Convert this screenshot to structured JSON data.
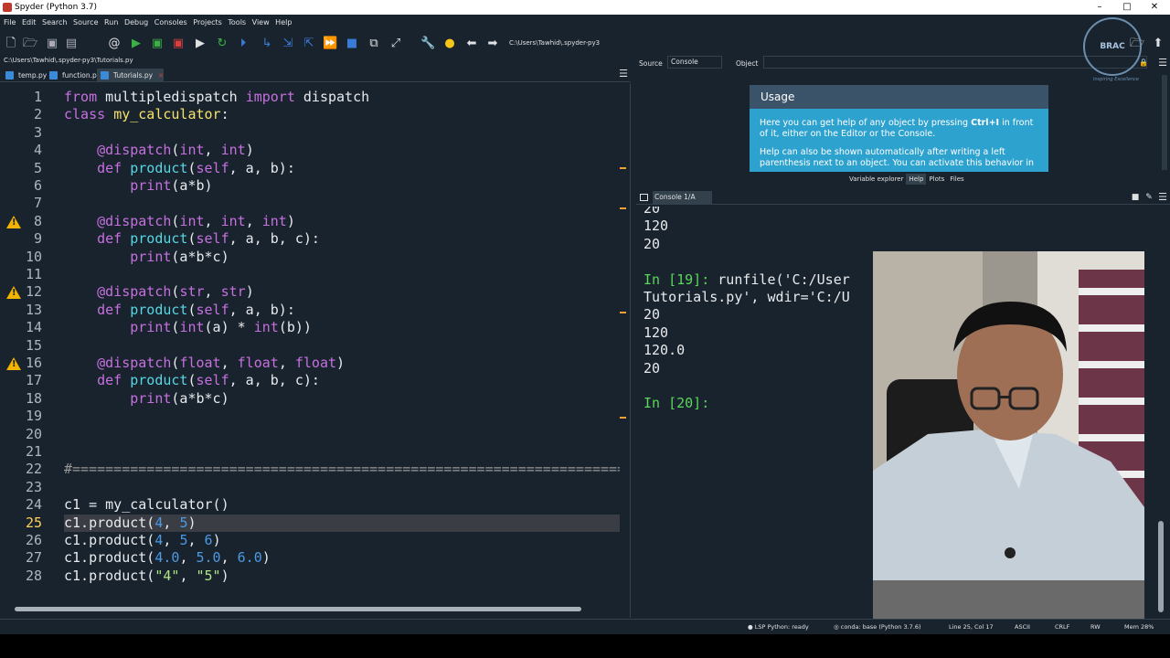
{
  "window": {
    "title": "Spyder (Python 3.7)",
    "min": "–",
    "max": "□",
    "close": "✕"
  },
  "menu": [
    "File",
    "Edit",
    "Search",
    "Source",
    "Run",
    "Debug",
    "Consoles",
    "Projects",
    "Tools",
    "View",
    "Help"
  ],
  "toolbar": {
    "path": "C:\\Users\\Tawhid\\.spyder-py3"
  },
  "cwd_label": "C:\\Users\\Tawhid\\.spyder-py3\\Tutorials.py",
  "editor": {
    "tabs": [
      {
        "label": "temp.py",
        "active": false
      },
      {
        "label": "function.py",
        "active": false
      },
      {
        "label": "Tutorials.py",
        "active": true
      }
    ],
    "close_glyph": "✕",
    "current_line": 25,
    "warning_lines": [
      8,
      12,
      16
    ],
    "lines": [
      [
        [
          "kw",
          "from"
        ],
        [
          "plain",
          " multipledispatch "
        ],
        [
          "kw",
          "import"
        ],
        [
          "plain",
          " dispatch"
        ]
      ],
      [
        [
          "kw",
          "class"
        ],
        [
          "plain",
          " "
        ],
        [
          "cls",
          "my_calculator"
        ],
        [
          "plain",
          ":"
        ]
      ],
      [],
      [
        [
          "plain",
          "    "
        ],
        [
          "dec",
          "@dispatch"
        ],
        [
          "plain",
          "("
        ],
        [
          "bi",
          "int"
        ],
        [
          "plain",
          ", "
        ],
        [
          "bi",
          "int"
        ],
        [
          "plain",
          ")"
        ]
      ],
      [
        [
          "plain",
          "    "
        ],
        [
          "kw",
          "def"
        ],
        [
          "plain",
          " "
        ],
        [
          "fn",
          "product"
        ],
        [
          "plain",
          "("
        ],
        [
          "bi",
          "self"
        ],
        [
          "plain",
          ", a, b):"
        ]
      ],
      [
        [
          "plain",
          "        "
        ],
        [
          "bi",
          "print"
        ],
        [
          "plain",
          "(a*b)"
        ]
      ],
      [],
      [
        [
          "plain",
          "    "
        ],
        [
          "dec",
          "@dispatch"
        ],
        [
          "plain",
          "("
        ],
        [
          "bi",
          "int"
        ],
        [
          "plain",
          ", "
        ],
        [
          "bi",
          "int"
        ],
        [
          "plain",
          ", "
        ],
        [
          "bi",
          "int"
        ],
        [
          "plain",
          ")"
        ]
      ],
      [
        [
          "plain",
          "    "
        ],
        [
          "kw",
          "def"
        ],
        [
          "plain",
          " "
        ],
        [
          "fn",
          "product"
        ],
        [
          "plain",
          "("
        ],
        [
          "bi",
          "self"
        ],
        [
          "plain",
          ", a, b, c):"
        ]
      ],
      [
        [
          "plain",
          "        "
        ],
        [
          "bi",
          "print"
        ],
        [
          "plain",
          "(a*b*c)"
        ]
      ],
      [],
      [
        [
          "plain",
          "    "
        ],
        [
          "dec",
          "@dispatch"
        ],
        [
          "plain",
          "("
        ],
        [
          "bi",
          "str"
        ],
        [
          "plain",
          ", "
        ],
        [
          "bi",
          "str"
        ],
        [
          "plain",
          ")"
        ]
      ],
      [
        [
          "plain",
          "    "
        ],
        [
          "kw",
          "def"
        ],
        [
          "plain",
          " "
        ],
        [
          "fn",
          "product"
        ],
        [
          "plain",
          "("
        ],
        [
          "bi",
          "self"
        ],
        [
          "plain",
          ", a, b):"
        ]
      ],
      [
        [
          "plain",
          "        "
        ],
        [
          "bi",
          "print"
        ],
        [
          "plain",
          "("
        ],
        [
          "bi",
          "int"
        ],
        [
          "plain",
          "(a) * "
        ],
        [
          "bi",
          "int"
        ],
        [
          "plain",
          "(b))"
        ]
      ],
      [],
      [
        [
          "plain",
          "    "
        ],
        [
          "dec",
          "@dispatch"
        ],
        [
          "plain",
          "("
        ],
        [
          "bi",
          "float"
        ],
        [
          "plain",
          ", "
        ],
        [
          "bi",
          "float"
        ],
        [
          "plain",
          ", "
        ],
        [
          "bi",
          "float"
        ],
        [
          "plain",
          ")"
        ]
      ],
      [
        [
          "plain",
          "    "
        ],
        [
          "kw",
          "def"
        ],
        [
          "plain",
          " "
        ],
        [
          "fn",
          "product"
        ],
        [
          "plain",
          "("
        ],
        [
          "bi",
          "self"
        ],
        [
          "plain",
          ", a, b, c):"
        ]
      ],
      [
        [
          "plain",
          "        "
        ],
        [
          "bi",
          "print"
        ],
        [
          "plain",
          "(a*b*c)"
        ]
      ],
      [],
      [],
      [],
      [
        [
          "cmt",
          "#==========================================================================="
        ]
      ],
      [],
      [
        [
          "plain",
          "c1 = my_calculator()"
        ]
      ],
      [
        [
          "plain",
          "c1.product("
        ],
        [
          "num2",
          "4"
        ],
        [
          "plain",
          ", "
        ],
        [
          "num2",
          "5"
        ],
        [
          "plain",
          ")"
        ]
      ],
      [
        [
          "plain",
          "c1.product("
        ],
        [
          "num2",
          "4"
        ],
        [
          "plain",
          ", "
        ],
        [
          "num2",
          "5"
        ],
        [
          "plain",
          ", "
        ],
        [
          "num2",
          "6"
        ],
        [
          "plain",
          ")"
        ]
      ],
      [
        [
          "plain",
          "c1.product("
        ],
        [
          "num2",
          "4.0"
        ],
        [
          "plain",
          ", "
        ],
        [
          "num2",
          "5.0"
        ],
        [
          "plain",
          ", "
        ],
        [
          "num2",
          "6.0"
        ],
        [
          "plain",
          ")"
        ]
      ],
      [
        [
          "plain",
          "c1.product("
        ],
        [
          "str",
          "\"4\""
        ],
        [
          "plain",
          ", "
        ],
        [
          "str",
          "\"5\""
        ],
        [
          "plain",
          ")"
        ]
      ]
    ]
  },
  "help": {
    "source_label": "Source",
    "source_value": "Console",
    "object_label": "Object",
    "usage_title": "Usage",
    "usage_p1_pre": "Here you can get help of any object by pressing ",
    "usage_p1_bold": "Ctrl+I",
    "usage_p1_post": " in front of it, either on the Editor or the Console.",
    "usage_p2": "Help can also be shown automatically after writing a left parenthesis next to an object. You can activate this behavior in",
    "tabs": [
      {
        "label": "Variable explorer",
        "active": false
      },
      {
        "label": "Help",
        "active": true
      },
      {
        "label": "Plots",
        "active": false
      },
      {
        "label": "Files",
        "active": false
      }
    ]
  },
  "console": {
    "tab_label": "Console 1/A",
    "lines": [
      {
        "type": "out",
        "text": "20"
      },
      {
        "type": "out",
        "text": "120"
      },
      {
        "type": "out",
        "text": "20"
      },
      {
        "type": "blank",
        "text": ""
      },
      {
        "type": "in",
        "prompt": "In [19]: ",
        "text": "runfile('C:/User"
      },
      {
        "type": "out",
        "text": "Tutorials.py', wdir='C:/U"
      },
      {
        "type": "out",
        "text": "20"
      },
      {
        "type": "out",
        "text": "120"
      },
      {
        "type": "out",
        "text": "120.0"
      },
      {
        "type": "out",
        "text": "20"
      },
      {
        "type": "blank",
        "text": ""
      },
      {
        "type": "in",
        "prompt": "In [20]: ",
        "text": ""
      }
    ]
  },
  "logo": {
    "text": "BRAC",
    "tagline": "Inspiring Excellence"
  },
  "statusbar": {
    "lsp": "LSP Python: ready",
    "conda": "conda: base (Python 3.7.6)",
    "position": "Line 25, Col 17",
    "encoding": "ASCII",
    "eol": "CRLF",
    "perm": "RW",
    "mem": "Mem 28%"
  },
  "colors": {
    "background": "#19232d",
    "usage_box": "#2ea2cf",
    "keyword": "#c670e0",
    "function": "#57d6e4",
    "class": "#f5e36b",
    "number": "#4c9ae4",
    "string": "#b0e686",
    "prompt": "#5bd75b",
    "warning": "#f2b400"
  }
}
